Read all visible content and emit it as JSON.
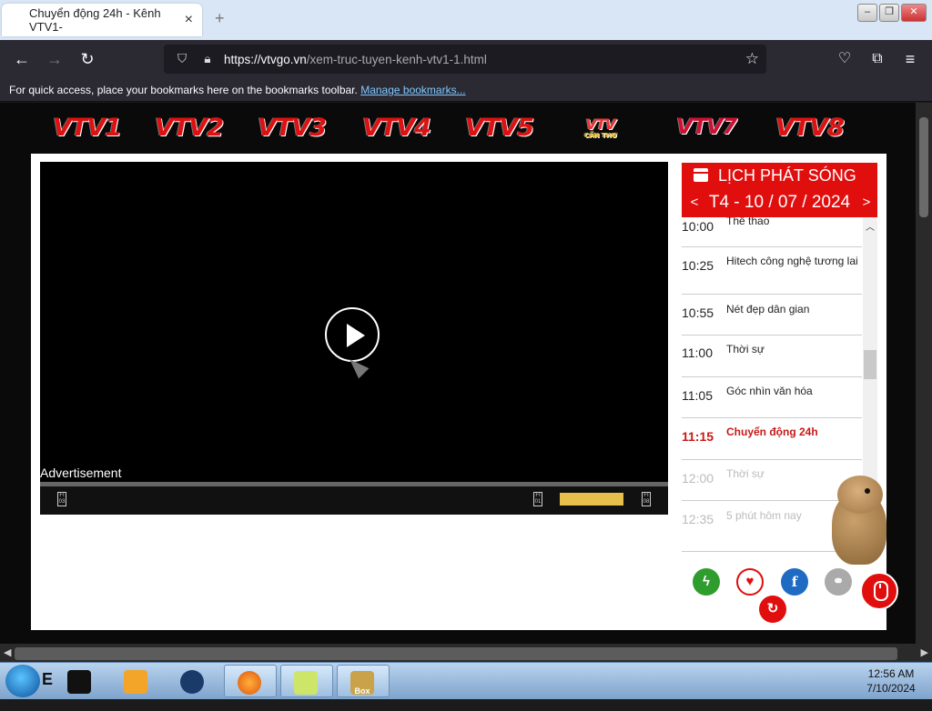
{
  "browser": {
    "tab_title": "Chuyển động 24h - Kênh VTV1-",
    "tab_close": "×",
    "new_tab": "+",
    "url_host": "https://vtvgo.vn",
    "url_path": "/xem-truc-tuyen-kenh-vtv1-1.html",
    "bookmarks_text": "For quick access, place your bookmarks here on the bookmarks toolbar.",
    "manage_bookmarks": "Manage bookmarks..."
  },
  "channels": [
    "VTV1",
    "VTV2",
    "VTV3",
    "VTV4",
    "VTV5",
    "VTV",
    "VTV7",
    "VTV8"
  ],
  "channel_cantho_sub": "CẦN THƠ",
  "player": {
    "ad_label": "Advertisement",
    "markers": [
      "03",
      "01",
      "08"
    ]
  },
  "schedule": {
    "title": "LỊCH PHÁT SÓNG",
    "prev": "<",
    "next": ">",
    "date": "T4 - 10 / 07 / 2024",
    "items": [
      {
        "time": "10:00",
        "name": "Thể thao",
        "state": "normal"
      },
      {
        "time": "10:25",
        "name": "Hitech công nghệ tương lai",
        "state": "normal"
      },
      {
        "time": "10:55",
        "name": "Nét đẹp dân gian",
        "state": "normal"
      },
      {
        "time": "11:00",
        "name": "Thời sự",
        "state": "normal"
      },
      {
        "time": "11:05",
        "name": "Góc nhìn văn hóa",
        "state": "normal"
      },
      {
        "time": "11:15",
        "name": "Chuyển động 24h",
        "state": "current"
      },
      {
        "time": "12:00",
        "name": "Thời sự",
        "state": "past"
      },
      {
        "time": "12:35",
        "name": "5 phút hôm nay",
        "state": "past"
      }
    ]
  },
  "taskbar": {
    "start_label": "E",
    "clock_time": "12:56 AM",
    "clock_date": "7/10/2024",
    "box_label": "Box"
  },
  "colors": {
    "brand_red": "#e10e0e",
    "current_program": "#c91818",
    "progress_yellow": "#e6c04a"
  }
}
